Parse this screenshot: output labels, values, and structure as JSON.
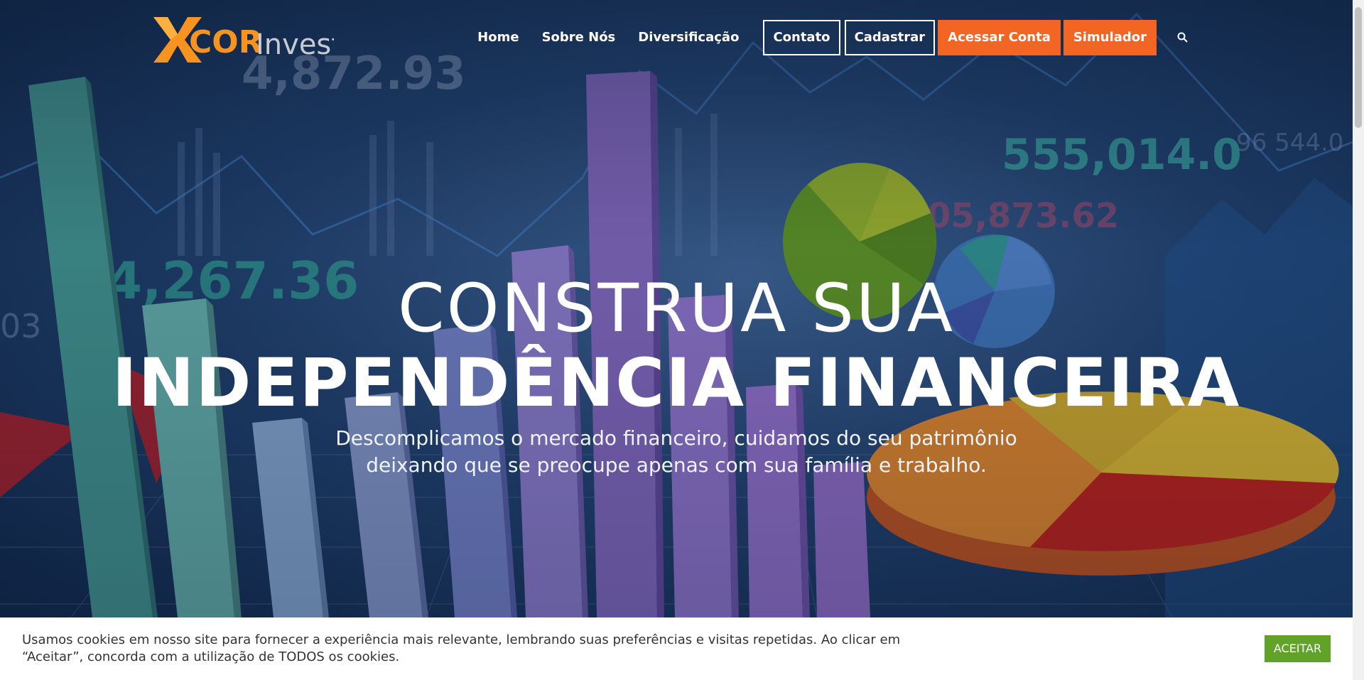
{
  "brand": {
    "logo_text_x": "X",
    "logo_text_cor": "COR",
    "logo_text_invest": "Invest",
    "accent": "#f26522"
  },
  "nav": {
    "home": "Home",
    "sobre": "Sobre Nós",
    "diversificacao": "Diversificação",
    "contato": "Contato",
    "cadastrar": "Cadastrar",
    "acessar": "Acessar Conta",
    "simulador": "Simulador",
    "search_icon": "search-icon"
  },
  "hero": {
    "line1": "CONSTRUA SUA",
    "line2": "INDEPENDÊNCIA FINANCEIRA",
    "sub1": "Descomplicamos o mercado financeiro, cuidamos do seu patrimônio",
    "sub2": "deixando que se preocupe apenas com sua família e trabalho.",
    "bg_numbers": [
      "4,872.93",
      "555,014.0",
      "05,873.62",
      "4,267.36",
      "96 544.0",
      "03"
    ]
  },
  "cookie": {
    "text": "Usamos cookies em nosso site para fornecer a experiência mais relevante, lembrando suas preferências e visitas repetidas. Ao clicar em “Aceitar”, concorda com a utilização de TODOS os cookies.",
    "button": "ACEITAR",
    "button_color": "#61a229"
  }
}
